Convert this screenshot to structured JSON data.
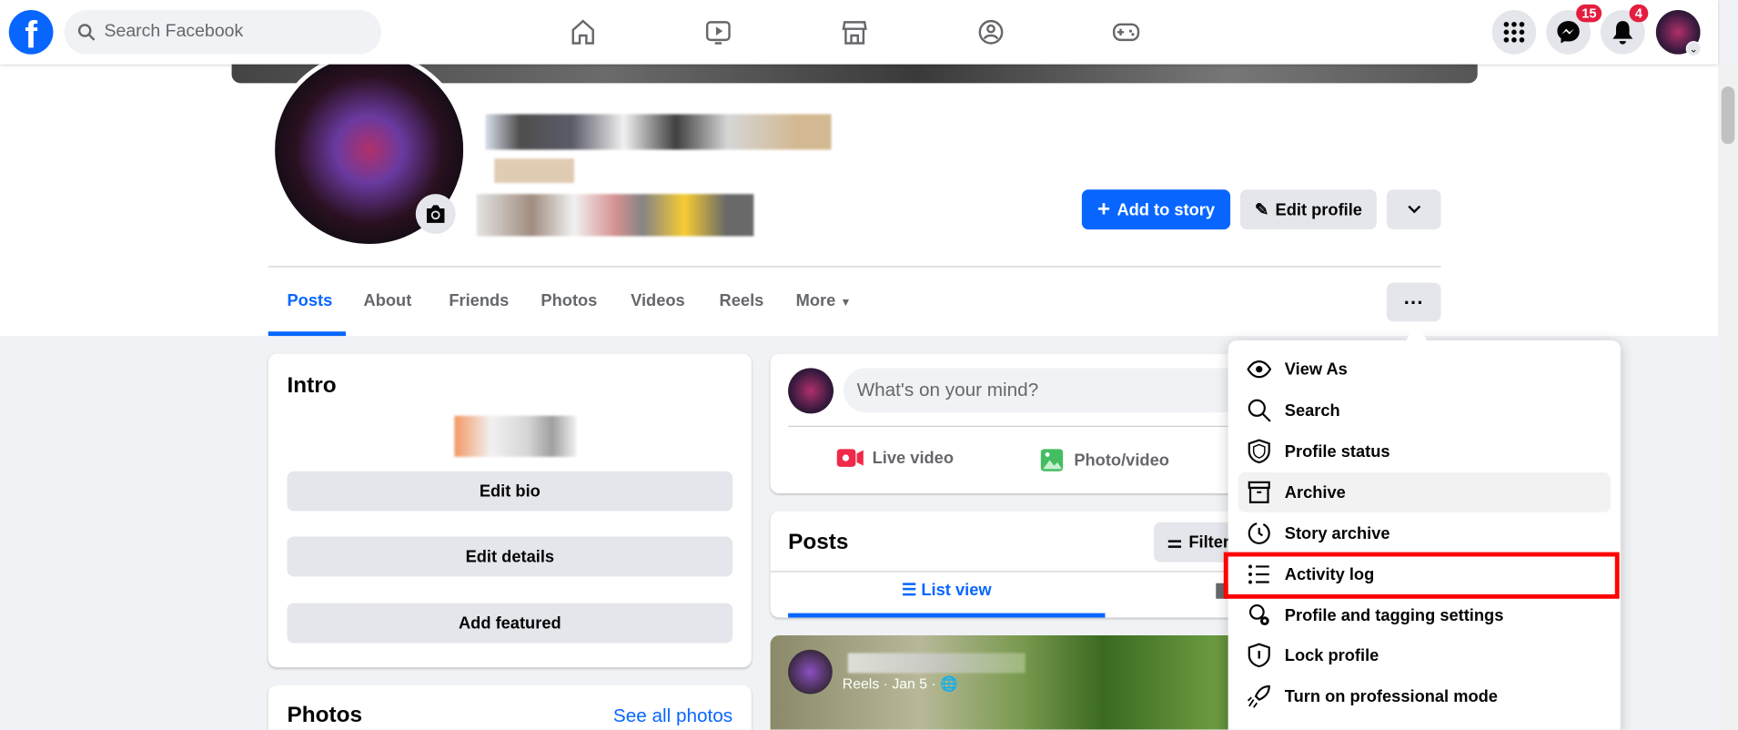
{
  "topbar": {
    "search_placeholder": "Search Facebook",
    "logo": "f",
    "nav_icons": [
      "home-icon",
      "video-icon",
      "marketplace-icon",
      "groups-icon",
      "gaming-icon"
    ],
    "messenger_badge": "15",
    "notifications_badge": "4"
  },
  "profile": {
    "add_to_story": "Add to story",
    "edit_profile": "Edit profile"
  },
  "tabs": [
    {
      "label": "Posts",
      "active": true
    },
    {
      "label": "About"
    },
    {
      "label": "Friends"
    },
    {
      "label": "Photos"
    },
    {
      "label": "Videos"
    },
    {
      "label": "Reels"
    },
    {
      "label": "More"
    }
  ],
  "intro": {
    "title": "Intro",
    "buttons": [
      "Edit bio",
      "Edit details",
      "Add featured"
    ]
  },
  "photos": {
    "title": "Photos",
    "see_all": "See all photos"
  },
  "composer": {
    "placeholder": "What's on your mind?",
    "live_video": "Live video",
    "photo_video": "Photo/video"
  },
  "posts": {
    "title": "Posts",
    "filter": "Filters",
    "list_view": "List view"
  },
  "post": {
    "meta": "Reels · Jan 5 · "
  },
  "menu": {
    "items": [
      "View As",
      "Search",
      "Profile status",
      "Archive",
      "Story archive",
      "Activity log",
      "Profile and tagging settings",
      "Lock profile",
      "Turn on professional mode"
    ],
    "hovered": "Archive",
    "highlighted": "Activity log"
  },
  "colors": {
    "accent": "#0866ff",
    "highlight": "#ff0000",
    "badge": "#e41e3f"
  }
}
